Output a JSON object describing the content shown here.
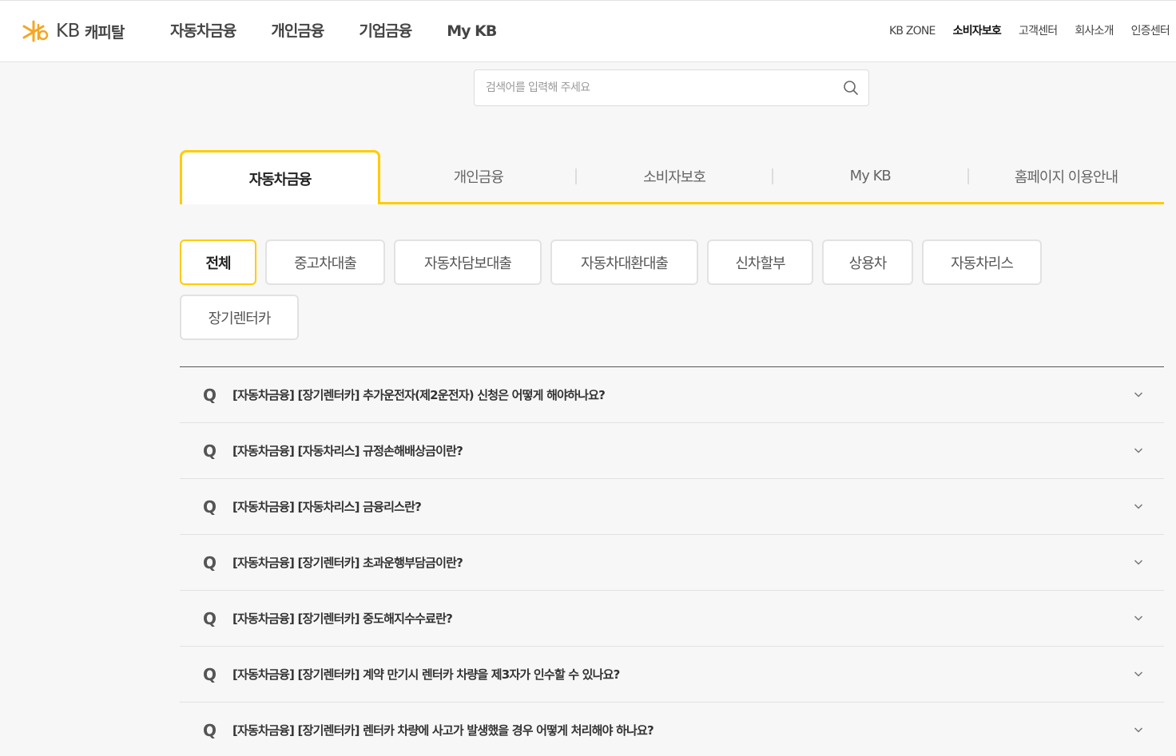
{
  "header": {
    "logo_kb": "KB",
    "logo_name": "캐피탈",
    "gnb": [
      "자동차금융",
      "개인금융",
      "기업금융",
      "My KB"
    ],
    "util": [
      "KB ZONE",
      "소비자보호",
      "고객센터",
      "회사소개",
      "인증센터"
    ],
    "util_active": "소비자보호"
  },
  "search": {
    "placeholder": "검색어를 입력해 주세요",
    "value": ""
  },
  "tabs": [
    "자동차금융",
    "개인금융",
    "소비자보호",
    "My KB",
    "홈페이지 이용안내"
  ],
  "active_tab": "자동차금융",
  "chips": [
    "전체",
    "중고차대출",
    "자동차담보대출",
    "자동차대환대출",
    "신차할부",
    "상용차",
    "자동차리스",
    "장기렌터카"
  ],
  "active_chip": "전체",
  "faq": {
    "q_mark": "Q",
    "items": [
      "[자동차금융] [장기렌터카] 추가운전자(제2운전자) 신청은 어떻게 해야하나요?",
      "[자동차금융] [자동차리스] 규정손해배상금이란?",
      "[자동차금융] [자동차리스] 금융리스란?",
      "[자동차금융] [장기렌터카] 초과운행부담금이란?",
      "[자동차금융] [장기렌터카] 중도해지수수료란?",
      "[자동차금융] [장기렌터카] 계약 만기시 렌터카 차량을 제3자가 인수할 수 있나요?",
      "[자동차금융] [장기렌터카] 렌터카 차량에 사고가 발생했을 경우 어떻게 처리해야 하나요?"
    ]
  },
  "colors": {
    "accent": "#ffcc00",
    "logo_orange": "#f5a623"
  },
  "icons": {
    "search": "search-icon",
    "chevron": "chevron-down-icon",
    "logo": "kb-star-logo-icon"
  }
}
